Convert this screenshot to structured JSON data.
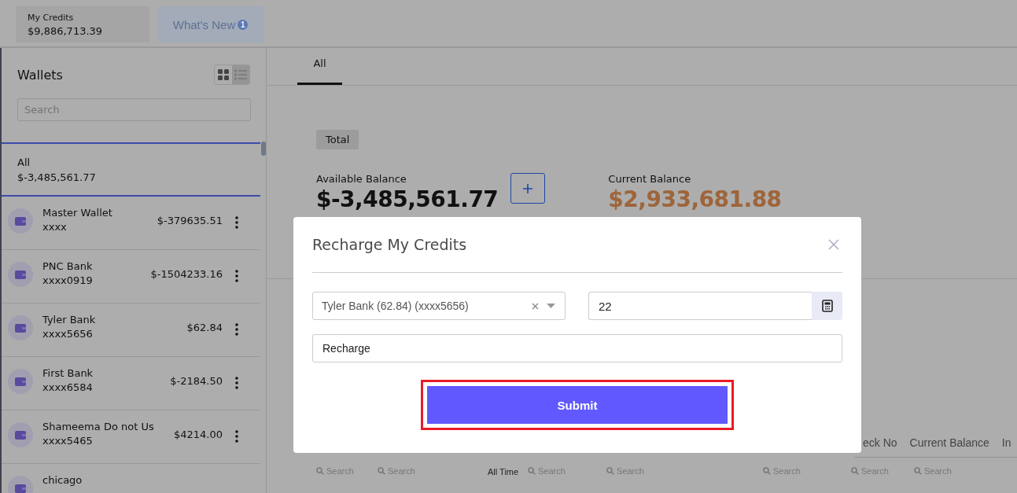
{
  "header": {
    "credits": {
      "label": "My Credits",
      "amount": "$9,886,713.39"
    },
    "whats_new": {
      "label": "What's New",
      "badge": "1"
    }
  },
  "sidebar": {
    "title": "Wallets",
    "view_toggle": [
      {
        "kind": "grid",
        "selected": true
      },
      {
        "kind": "list",
        "selected": false
      }
    ],
    "search": {
      "placeholder": "Search"
    },
    "all_item": {
      "label": "All",
      "amount": "$-3,485,561.77",
      "selected": true
    },
    "wallets": [
      {
        "name": "Master Wallet",
        "account": "xxxx",
        "amount": "$-379635.51"
      },
      {
        "name": "PNC Bank",
        "account": "xxxx0919",
        "amount": "$-1504233.16"
      },
      {
        "name": "Tyler Bank",
        "account": "xxxx5656",
        "amount": "$62.84"
      },
      {
        "name": "First Bank",
        "account": "xxxx6584",
        "amount": "$-2184.50"
      },
      {
        "name": "Shameema Do not Us",
        "account": "xxxx5465",
        "amount": "$4214.00"
      },
      {
        "name": "chicago"
      }
    ]
  },
  "main": {
    "tabs": [
      {
        "label": "All",
        "selected": true
      }
    ],
    "total_tag": "Total",
    "available": {
      "label": "Available Balance",
      "amount": "$-3,485,561.77"
    },
    "current": {
      "label": "Current Balance",
      "amount": "$2,933,681.88"
    },
    "table": {
      "columns": [
        "eck No",
        "Current Balance",
        "In"
      ],
      "filters": [
        {
          "kind": "search",
          "text": "Search"
        },
        {
          "kind": "search",
          "text": "Search"
        },
        {
          "kind": "label",
          "text": "All Time"
        },
        {
          "kind": "search",
          "text": "Search"
        },
        {
          "kind": "search",
          "text": "Search"
        },
        {
          "kind": "search",
          "text": "Search"
        },
        {
          "kind": "search",
          "text": "Search"
        },
        {
          "kind": "search",
          "text": "Search"
        }
      ]
    }
  },
  "dialog": {
    "title": "Recharge My Credits",
    "wallet_select": {
      "value": "Tyler Bank (62.84) (xxxx5656)"
    },
    "amount": {
      "value": "22"
    },
    "note": {
      "value": "Recharge"
    },
    "submit": "Submit",
    "highlighted": true
  }
}
